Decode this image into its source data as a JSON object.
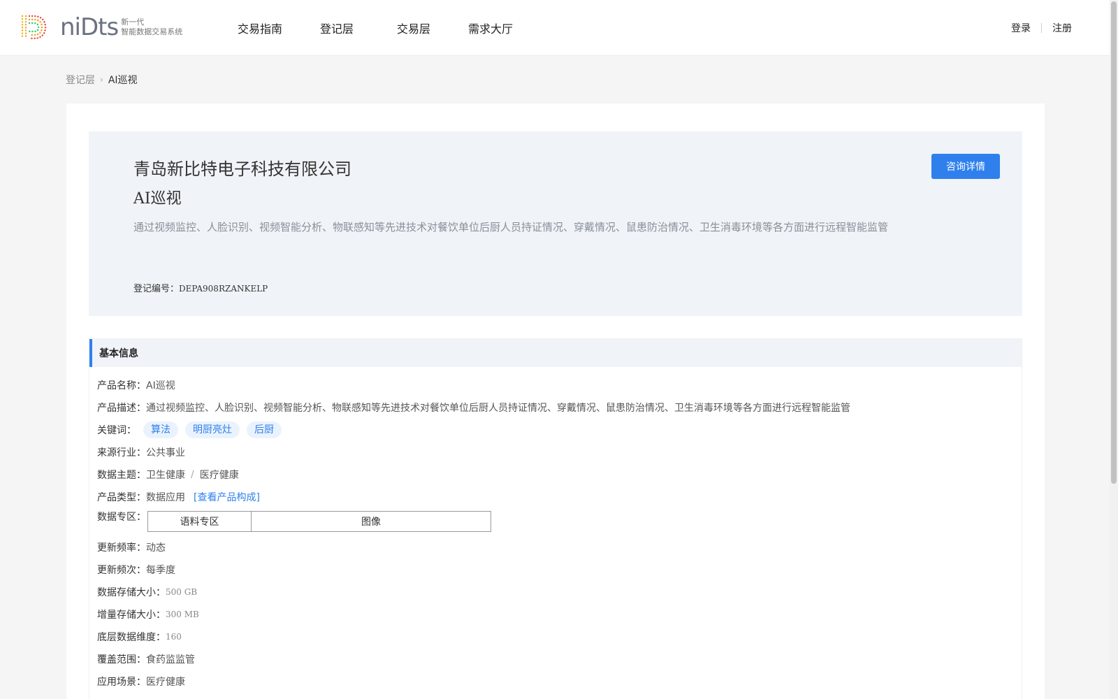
{
  "header": {
    "logo_word": "niDts",
    "logo_sub_line1": "新一代",
    "logo_sub_line2": "智能数据交易系统",
    "nav": [
      "交易指南",
      "登记层",
      "交易层",
      "需求大厅"
    ],
    "login": "登录",
    "register": "注册"
  },
  "breadcrumb": {
    "root": "登记层",
    "current": "AI巡视"
  },
  "hero": {
    "company": "青岛新比特电子科技有限公司",
    "product": "AI巡视",
    "description": "通过视频监控、人脸识别、视频智能分析、物联感知等先进技术对餐饮单位后厨人员持证情况、穿戴情况、鼠患防治情况、卫生消毒环境等各方面进行远程智能监管",
    "reg_label": "登记编号：",
    "reg_value": "DEPA908RZANKELP",
    "consult_button": "咨询详情"
  },
  "basic_info": {
    "title": "基本信息",
    "product_name": {
      "label": "产品名称：",
      "value": "AI巡视"
    },
    "product_desc": {
      "label": "产品描述：",
      "value": "通过视频监控、人脸识别、视频智能分析、物联感知等先进技术对餐饮单位后厨人员持证情况、穿戴情况、鼠患防治情况、卫生消毒环境等各方面进行远程智能监管"
    },
    "keywords": {
      "label": "关键词：",
      "tags": [
        "算法",
        "明厨亮灶",
        "后厨"
      ]
    },
    "industry": {
      "label": "来源行业：",
      "value": "公共事业"
    },
    "topic": {
      "label": "数据主题：",
      "value1": "卫生健康",
      "sep": "/",
      "value2": "医疗健康"
    },
    "product_type": {
      "label": "产品类型：",
      "value": "数据应用",
      "link": "[查看产品构成]"
    },
    "data_zone": {
      "label": "数据专区：",
      "col1": "语料专区",
      "col2": "图像"
    },
    "update_rate": {
      "label": "更新频率：",
      "value": "动态"
    },
    "update_freq": {
      "label": "更新频次：",
      "value": "每季度"
    },
    "storage": {
      "label": "数据存储大小：",
      "value": "500 GB"
    },
    "incr_storage": {
      "label": "增量存储大小：",
      "value": "300 MB"
    },
    "dimension": {
      "label": "底层数据维度：",
      "value": "160"
    },
    "coverage": {
      "label": "覆盖范围：",
      "value": "食药监监管"
    },
    "scenario": {
      "label": "应用场景：",
      "value": "医疗健康"
    }
  }
}
